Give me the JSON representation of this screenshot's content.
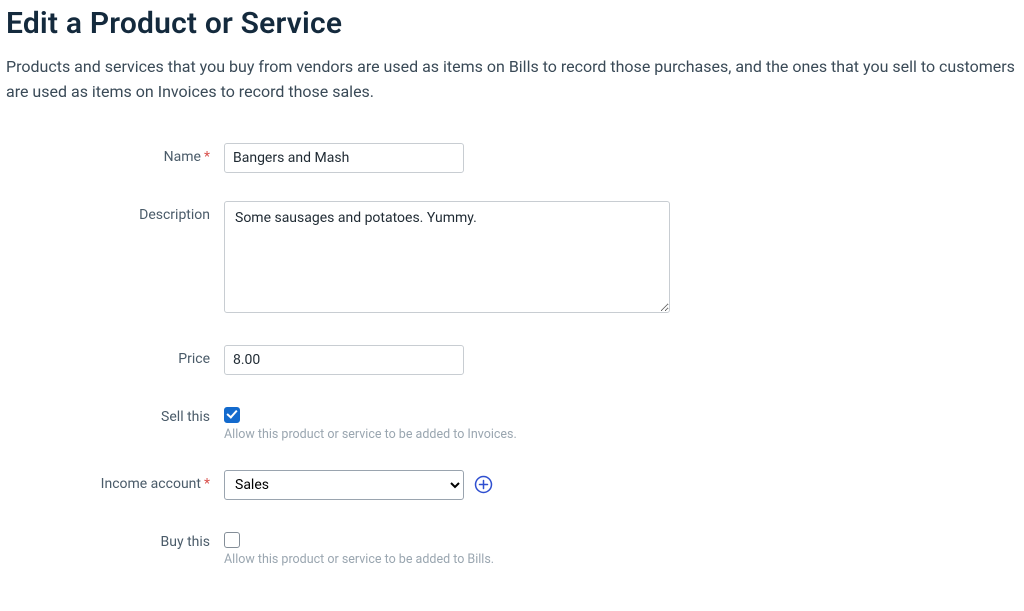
{
  "page": {
    "title": "Edit a Product or Service",
    "description": "Products and services that you buy from vendors are used as items on Bills to record those purchases, and the ones that you sell to customers are used as items on Invoices to record those sales."
  },
  "form": {
    "name": {
      "label": "Name",
      "value": "Bangers and Mash"
    },
    "description": {
      "label": "Description",
      "value": "Some sausages and potatoes. Yummy."
    },
    "price": {
      "label": "Price",
      "value": "8.00"
    },
    "sell": {
      "label": "Sell this",
      "helper": "Allow this product or service to be added to Invoices."
    },
    "income_account": {
      "label": "Income account",
      "selected": "Sales",
      "options": [
        "Sales"
      ]
    },
    "buy": {
      "label": "Buy this",
      "helper": "Allow this product or service to be added to Bills."
    }
  }
}
